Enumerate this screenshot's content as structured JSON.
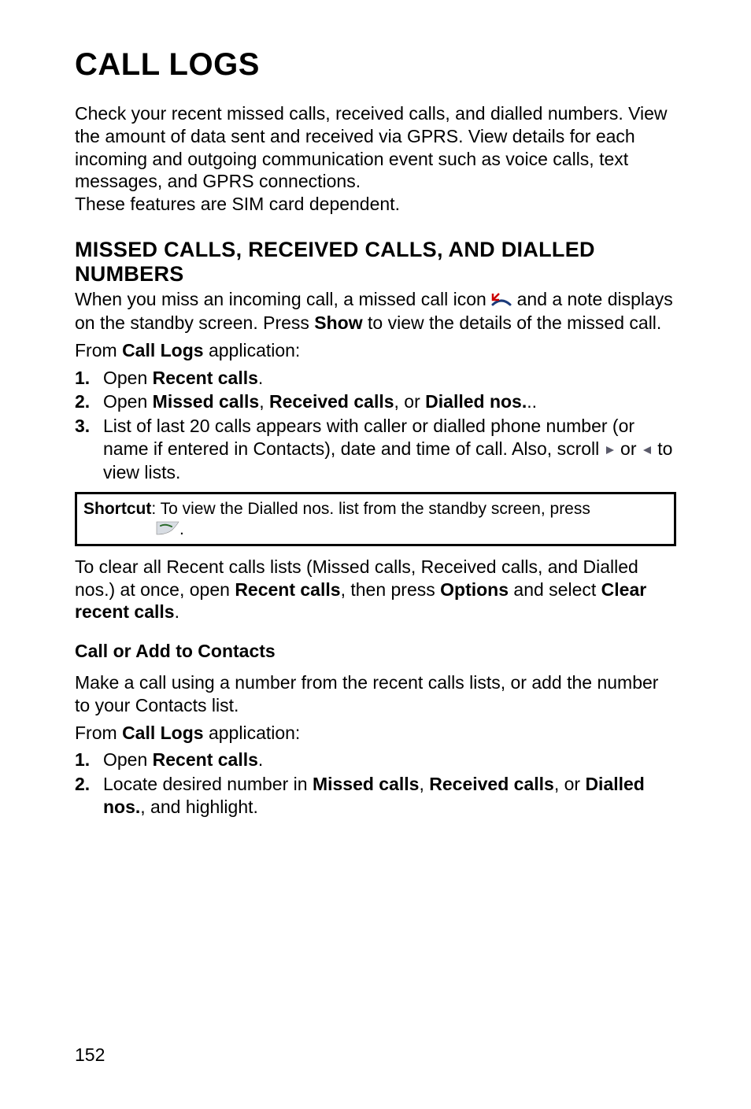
{
  "page": {
    "title": "CALL LOGS",
    "intro_p1": "Check your recent missed calls, received calls, and dialled numbers. View the amount of data sent and received via GPRS. View details for each incoming and outgoing communication event such as voice calls, text messages, and GPRS connections.",
    "intro_p2": "These features are SIM card dependent.",
    "section1": {
      "heading": "MISSED CALLS, RECEIVED CALLS, AND DIALLED NUMBERS",
      "p1_a": "When you miss an incoming call, a missed call icon ",
      "p1_b": " and a note displays on the standby screen. Press ",
      "p1_show": "Show",
      "p1_c": " to view the details of the missed call.",
      "p2_a": "From ",
      "p2_b": "Call Logs",
      "p2_c": " application:",
      "steps": [
        {
          "num": "1.",
          "a": "Open ",
          "b": "Recent calls",
          "c": "."
        },
        {
          "num": "2.",
          "a": "Open ",
          "b": "Missed calls",
          "c": ", ",
          "d": "Received calls",
          "e": ", or ",
          "f": "Dialled nos.",
          "g": ".."
        },
        {
          "num": "3.",
          "a": "List of last 20 calls appears with caller or dialled phone number (or name if entered in Contacts), date and time of call. Also, scroll ",
          "b": " or ",
          "c": " to view lists."
        }
      ],
      "shortcut_label": "Shortcut",
      "shortcut_text_a": ":  To view the Dialled nos. list from the standby screen, press ",
      "shortcut_text_b": ".",
      "clear_a": "To clear all Recent calls lists (Missed calls, Received calls, and Dialled nos.) at once, open ",
      "clear_b": "Recent calls",
      "clear_c": ", then press ",
      "clear_d": "Options",
      "clear_e": " and select ",
      "clear_f": "Clear recent calls",
      "clear_g": "."
    },
    "section2": {
      "heading": "Call or Add to Contacts",
      "p1": "Make a call using a number from the recent calls lists, or add the number to your Contacts list.",
      "p2_a": "From ",
      "p2_b": "Call Logs",
      "p2_c": " application:",
      "steps": [
        {
          "num": "1.",
          "a": "Open ",
          "b": "Recent calls",
          "c": "."
        },
        {
          "num": "2.",
          "a": "Locate desired number in ",
          "b": "Missed calls",
          "c": ", ",
          "d": "Received calls",
          "e": ", or ",
          "f": "Dialled nos.",
          "g": ", and highlight."
        }
      ]
    },
    "page_number": "152"
  },
  "icons": {
    "missed_call": "missed-call-icon",
    "scroll_right": "scroll-right-icon",
    "scroll_left": "scroll-left-icon",
    "send_key": "send-key-icon"
  }
}
